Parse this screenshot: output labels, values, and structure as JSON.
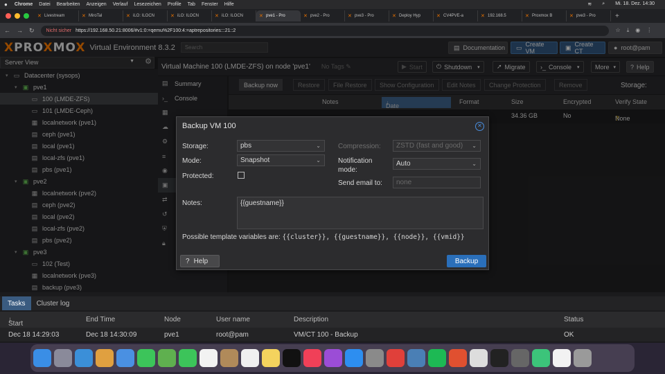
{
  "menubar": {
    "app": "Chrome",
    "items": [
      "Datei",
      "Bearbeiten",
      "Anzeigen",
      "Verlauf",
      "Lesezeichen",
      "Profile",
      "Tab",
      "Fenster",
      "Hilfe"
    ],
    "clock": "Mi. 18. Dez.  14:30"
  },
  "browser": {
    "tabs": [
      {
        "label": "Livestream"
      },
      {
        "label": "MiroTal"
      },
      {
        "label": "iLO: ILOCN"
      },
      {
        "label": "iLO: ILOCN"
      },
      {
        "label": "iLO: ILOCN"
      },
      {
        "label": "pve1 - Pro",
        "active": true
      },
      {
        "label": "pve2 - Pro"
      },
      {
        "label": "pve3 - Pro"
      },
      {
        "label": "Deploy Hyp"
      },
      {
        "label": "CV4PVE-a"
      },
      {
        "label": "192.168.5"
      },
      {
        "label": "Proxmox B"
      },
      {
        "label": "pve3 - Pro"
      }
    ],
    "not_secure": "Nicht sicher",
    "url": "https://192.168.50.21:8006/#v1:0:=qemu%2F100:4:=aptrepositories:::21::2"
  },
  "header": {
    "logo_prefix": "PRO",
    "logo_x": "X",
    "logo_suffix": "MO",
    "logo_x2": "X",
    "product": "Virtual Environment 8.3.2",
    "search_placeholder": "Search",
    "documentation": "Documentation",
    "create_vm": "Create VM",
    "create_ct": "Create CT",
    "user": "root@pam"
  },
  "sidebar": {
    "view": "Server View",
    "tree": [
      {
        "label": "Datacenter (sysops)",
        "level": 0,
        "icon": "datacenter-icon",
        "glyph": "▭"
      },
      {
        "label": "pve1",
        "level": 1,
        "icon": "node-icon",
        "glyph": "▣"
      },
      {
        "label": "100 (LMDE-ZFS)",
        "level": 2,
        "icon": "vm-icon",
        "glyph": "▭",
        "selected": true
      },
      {
        "label": "101 (LMDE-Ceph)",
        "level": 2,
        "icon": "vm-icon",
        "glyph": "▭"
      },
      {
        "label": "localnetwork (pve1)",
        "level": 2,
        "icon": "network-icon",
        "glyph": "▦"
      },
      {
        "label": "ceph (pve1)",
        "level": 2,
        "icon": "storage-icon",
        "glyph": "▤"
      },
      {
        "label": "local (pve1)",
        "level": 2,
        "icon": "storage-icon",
        "glyph": "▤"
      },
      {
        "label": "local-zfs (pve1)",
        "level": 2,
        "icon": "storage-icon",
        "glyph": "▤"
      },
      {
        "label": "pbs (pve1)",
        "level": 2,
        "icon": "storage-icon",
        "glyph": "▤"
      },
      {
        "label": "pve2",
        "level": 1,
        "icon": "node-icon",
        "glyph": "▣"
      },
      {
        "label": "localnetwork (pve2)",
        "level": 2,
        "icon": "network-icon",
        "glyph": "▦"
      },
      {
        "label": "ceph (pve2)",
        "level": 2,
        "icon": "storage-icon",
        "glyph": "▤"
      },
      {
        "label": "local (pve2)",
        "level": 2,
        "icon": "storage-icon",
        "glyph": "▤"
      },
      {
        "label": "local-zfs (pve2)",
        "level": 2,
        "icon": "storage-icon",
        "glyph": "▤"
      },
      {
        "label": "pbs (pve2)",
        "level": 2,
        "icon": "storage-icon",
        "glyph": "▤"
      },
      {
        "label": "pve3",
        "level": 1,
        "icon": "node-icon",
        "glyph": "▣"
      },
      {
        "label": "102 (Test)",
        "level": 2,
        "icon": "vm-icon",
        "glyph": "▭"
      },
      {
        "label": "localnetwork (pve3)",
        "level": 2,
        "icon": "network-icon",
        "glyph": "▦"
      },
      {
        "label": "backup (pve3)",
        "level": 2,
        "icon": "storage-icon",
        "glyph": "▤"
      }
    ]
  },
  "vm": {
    "title": "Virtual Machine 100 (LMDE-ZFS) on node 'pve1'",
    "tags": "No Tags",
    "start": "Start",
    "shutdown": "Shutdown",
    "migrate": "Migrate",
    "console": "Console",
    "more": "More",
    "help": "Help"
  },
  "subnav": [
    {
      "label": "Summary",
      "icon": "summary-icon",
      "glyph": "▤"
    },
    {
      "label": "Console",
      "icon": "console-icon",
      "glyph": "›_"
    }
  ],
  "backup_toolbar": {
    "backup_now": "Backup now",
    "restore": "Restore",
    "file_restore": "File Restore",
    "show_config": "Show Configuration",
    "edit_notes": "Edit Notes",
    "change_protection": "Change Protection",
    "remove": "Remove",
    "storage_label": "Storage:"
  },
  "backup_table": {
    "columns": [
      "Notes",
      "Date",
      "Format",
      "Size",
      "Encrypted",
      "Verify State"
    ],
    "row": {
      "size": "34.36 GB",
      "encrypted": "No",
      "verify": "None"
    }
  },
  "dialog": {
    "title": "Backup VM 100",
    "storage_label": "Storage:",
    "storage_value": "pbs",
    "mode_label": "Mode:",
    "mode_value": "Snapshot",
    "protected_label": "Protected:",
    "compression_label": "Compression:",
    "compression_value": "ZSTD (fast and good)",
    "notification_label": "Notification mode:",
    "notification_value": "Auto",
    "email_label": "Send email to:",
    "email_placeholder": "none",
    "notes_label": "Notes:",
    "notes_value": "{{guestname}}",
    "template_prefix": "Possible template variables are: ",
    "template_vars": "{{cluster}}, {{guestname}}, {{node}}, {{vmid}}",
    "help": "Help",
    "backup": "Backup"
  },
  "tasks": {
    "tab_tasks": "Tasks",
    "tab_cluster_log": "Cluster log",
    "columns": [
      "Start Time",
      "End Time",
      "Node",
      "User name",
      "Description",
      "Status"
    ],
    "row": {
      "start": "Dec 18 14:29:03",
      "end": "Dec 18 14:30:09",
      "node": "pve1",
      "user": "root@pam",
      "description": "VM/CT 100 - Backup",
      "status": "OK"
    }
  },
  "dock": {
    "apps": [
      {
        "name": "finder-icon",
        "color": "#3a8ee6"
      },
      {
        "name": "launchpad-icon",
        "color": "#8a8a9a"
      },
      {
        "name": "safari-icon",
        "color": "#3b8fd8"
      },
      {
        "name": "photos-icon",
        "color": "#e0a040"
      },
      {
        "name": "mail-icon",
        "color": "#4a90e2"
      },
      {
        "name": "messages-icon",
        "color": "#3cc45a"
      },
      {
        "name": "maps-icon",
        "color": "#5fb04f"
      },
      {
        "name": "facetime-icon",
        "color": "#3cc45a"
      },
      {
        "name": "calendar-icon",
        "color": "#f2f2f2"
      },
      {
        "name": "contacts-icon",
        "color": "#b08a5a"
      },
      {
        "name": "reminders-icon",
        "color": "#f0f0f0"
      },
      {
        "name": "notes-icon",
        "color": "#f4d35e"
      },
      {
        "name": "tv-icon",
        "color": "#111111"
      },
      {
        "name": "music-icon",
        "color": "#f04058"
      },
      {
        "name": "podcasts-icon",
        "color": "#9b4dd6"
      },
      {
        "name": "appstore-icon",
        "color": "#2d8ef0"
      },
      {
        "name": "settings-icon",
        "color": "#8a8a8a"
      },
      {
        "name": "pocketcasts-icon",
        "color": "#e0403a"
      },
      {
        "name": "proxyman-icon",
        "color": "#4a7fb5"
      },
      {
        "name": "spotify-icon",
        "color": "#1db954"
      },
      {
        "name": "cert-icon",
        "color": "#e05030"
      },
      {
        "name": "chrome-icon",
        "color": "#dddddd"
      },
      {
        "name": "terminal-icon",
        "color": "#222222"
      },
      {
        "name": "calculator-icon",
        "color": "#666666"
      },
      {
        "name": "sync-icon",
        "color": "#3cc47a"
      },
      {
        "name": "document-icon",
        "color": "#f2f2f2"
      },
      {
        "name": "trash-icon",
        "color": "#9a9a9a"
      }
    ]
  },
  "colors": {
    "accent": "#e57000",
    "primary_button": "#2a6fba",
    "selection": "#3b3d40"
  }
}
